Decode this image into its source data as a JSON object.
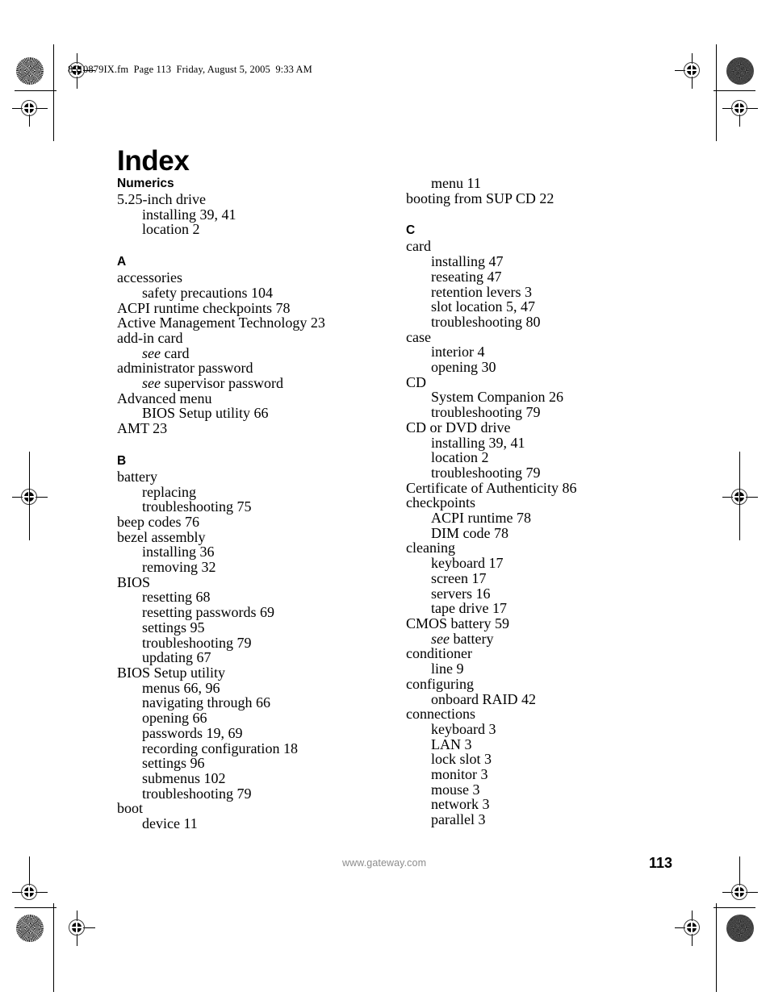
{
  "header": {
    "running_header": "8510879IX.fm  Page 113  Friday, August 5, 2005  9:33 AM"
  },
  "title": "Index",
  "footer": {
    "url": "www.gateway.com",
    "page_number": "113"
  },
  "columns": {
    "left": [
      {
        "type": "section",
        "label": "Numerics",
        "first": true
      },
      {
        "type": "entry",
        "level": 1,
        "text": "5.25-inch drive"
      },
      {
        "type": "entry",
        "level": 2,
        "text": "installing 39, 41"
      },
      {
        "type": "entry",
        "level": 2,
        "text": "location 2"
      },
      {
        "type": "section",
        "label": "A"
      },
      {
        "type": "entry",
        "level": 1,
        "text": "accessories"
      },
      {
        "type": "entry",
        "level": 2,
        "text": "safety precautions 104"
      },
      {
        "type": "entry",
        "level": 1,
        "text": "ACPI runtime checkpoints 78"
      },
      {
        "type": "entry",
        "level": 1,
        "text": "Active Management Technology 23"
      },
      {
        "type": "entry",
        "level": 1,
        "text": "add-in card"
      },
      {
        "type": "entry",
        "level": 2,
        "see": "see",
        "text": " card"
      },
      {
        "type": "entry",
        "level": 1,
        "text": "administrator password"
      },
      {
        "type": "entry",
        "level": 2,
        "see": "see",
        "text": " supervisor password"
      },
      {
        "type": "entry",
        "level": 1,
        "text": "Advanced menu"
      },
      {
        "type": "entry",
        "level": 2,
        "text": "BIOS Setup utility 66"
      },
      {
        "type": "entry",
        "level": 1,
        "text": "AMT 23"
      },
      {
        "type": "section",
        "label": "B"
      },
      {
        "type": "entry",
        "level": 1,
        "text": "battery"
      },
      {
        "type": "entry",
        "level": 2,
        "text": "replacing"
      },
      {
        "type": "entry",
        "level": 2,
        "text": "troubleshooting 75"
      },
      {
        "type": "entry",
        "level": 1,
        "text": "beep codes 76"
      },
      {
        "type": "entry",
        "level": 1,
        "text": "bezel assembly"
      },
      {
        "type": "entry",
        "level": 2,
        "text": "installing 36"
      },
      {
        "type": "entry",
        "level": 2,
        "text": "removing 32"
      },
      {
        "type": "entry",
        "level": 1,
        "text": "BIOS"
      },
      {
        "type": "entry",
        "level": 2,
        "text": "resetting 68"
      },
      {
        "type": "entry",
        "level": 2,
        "text": "resetting passwords 69"
      },
      {
        "type": "entry",
        "level": 2,
        "text": "settings 95"
      },
      {
        "type": "entry",
        "level": 2,
        "text": "troubleshooting 79"
      },
      {
        "type": "entry",
        "level": 2,
        "text": "updating 67"
      },
      {
        "type": "entry",
        "level": 1,
        "text": "BIOS Setup utility"
      },
      {
        "type": "entry",
        "level": 2,
        "text": "menus 66, 96"
      },
      {
        "type": "entry",
        "level": 2,
        "text": "navigating through 66"
      },
      {
        "type": "entry",
        "level": 2,
        "text": "opening 66"
      },
      {
        "type": "entry",
        "level": 2,
        "text": "passwords 19, 69"
      },
      {
        "type": "entry",
        "level": 2,
        "text": "recording configuration 18"
      },
      {
        "type": "entry",
        "level": 2,
        "text": "settings 96"
      },
      {
        "type": "entry",
        "level": 2,
        "text": "submenus 102"
      },
      {
        "type": "entry",
        "level": 2,
        "text": "troubleshooting 79"
      },
      {
        "type": "entry",
        "level": 1,
        "text": "boot"
      },
      {
        "type": "entry",
        "level": 2,
        "text": "device 11"
      }
    ],
    "right": [
      {
        "type": "entry",
        "level": 2,
        "text": "menu 11",
        "first": true
      },
      {
        "type": "entry",
        "level": 1,
        "text": "booting from SUP CD 22"
      },
      {
        "type": "section",
        "label": "C"
      },
      {
        "type": "entry",
        "level": 1,
        "text": "card"
      },
      {
        "type": "entry",
        "level": 2,
        "text": "installing 47"
      },
      {
        "type": "entry",
        "level": 2,
        "text": "reseating 47"
      },
      {
        "type": "entry",
        "level": 2,
        "text": "retention levers 3"
      },
      {
        "type": "entry",
        "level": 2,
        "text": "slot location 5, 47"
      },
      {
        "type": "entry",
        "level": 2,
        "text": "troubleshooting 80"
      },
      {
        "type": "entry",
        "level": 1,
        "text": "case"
      },
      {
        "type": "entry",
        "level": 2,
        "text": "interior 4"
      },
      {
        "type": "entry",
        "level": 2,
        "text": "opening 30"
      },
      {
        "type": "entry",
        "level": 1,
        "text": "CD"
      },
      {
        "type": "entry",
        "level": 2,
        "text": "System Companion 26"
      },
      {
        "type": "entry",
        "level": 2,
        "text": "troubleshooting 79"
      },
      {
        "type": "entry",
        "level": 1,
        "text": "CD or DVD drive"
      },
      {
        "type": "entry",
        "level": 2,
        "text": "installing 39, 41"
      },
      {
        "type": "entry",
        "level": 2,
        "text": "location 2"
      },
      {
        "type": "entry",
        "level": 2,
        "text": "troubleshooting 79"
      },
      {
        "type": "entry",
        "level": 1,
        "text": "Certificate of Authenticity 86"
      },
      {
        "type": "entry",
        "level": 1,
        "text": "checkpoints"
      },
      {
        "type": "entry",
        "level": 2,
        "text": "ACPI runtime 78"
      },
      {
        "type": "entry",
        "level": 2,
        "text": "DIM code 78"
      },
      {
        "type": "entry",
        "level": 1,
        "text": "cleaning"
      },
      {
        "type": "entry",
        "level": 2,
        "text": "keyboard 17"
      },
      {
        "type": "entry",
        "level": 2,
        "text": "screen 17"
      },
      {
        "type": "entry",
        "level": 2,
        "text": "servers 16"
      },
      {
        "type": "entry",
        "level": 2,
        "text": "tape drive 17"
      },
      {
        "type": "entry",
        "level": 1,
        "text": "CMOS battery 59"
      },
      {
        "type": "entry",
        "level": 2,
        "see": "see",
        "text": " battery"
      },
      {
        "type": "entry",
        "level": 1,
        "text": "conditioner"
      },
      {
        "type": "entry",
        "level": 2,
        "text": "line 9"
      },
      {
        "type": "entry",
        "level": 1,
        "text": "configuring"
      },
      {
        "type": "entry",
        "level": 2,
        "text": "onboard RAID 42"
      },
      {
        "type": "entry",
        "level": 1,
        "text": "connections"
      },
      {
        "type": "entry",
        "level": 2,
        "text": "keyboard 3"
      },
      {
        "type": "entry",
        "level": 2,
        "text": "LAN 3"
      },
      {
        "type": "entry",
        "level": 2,
        "text": "lock slot 3"
      },
      {
        "type": "entry",
        "level": 2,
        "text": "monitor 3"
      },
      {
        "type": "entry",
        "level": 2,
        "text": "mouse 3"
      },
      {
        "type": "entry",
        "level": 2,
        "text": "network 3"
      },
      {
        "type": "entry",
        "level": 2,
        "text": "parallel 3"
      }
    ]
  },
  "print_marks": {
    "registration_mark_label": "registration-target",
    "density_patch_label": "density-patch"
  }
}
